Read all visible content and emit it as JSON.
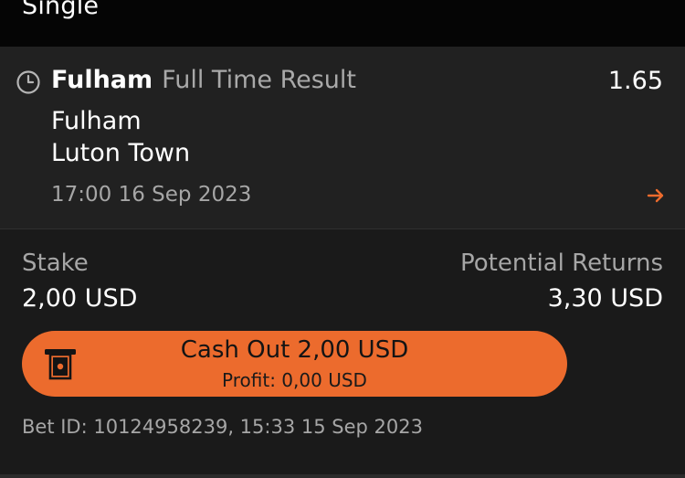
{
  "header": {
    "title": "Single"
  },
  "selection": {
    "team": "Fulham",
    "market": "Full Time Result",
    "odds": "1.65",
    "home_team": "Fulham",
    "away_team": "Luton Town",
    "kickoff": "17:00 16 Sep 2023",
    "icons": {
      "status": "clock-icon",
      "navigate": "arrow-right-icon"
    }
  },
  "bet": {
    "stake_label": "Stake",
    "stake_value": "2,00 USD",
    "returns_label": "Potential Returns",
    "returns_value": "3,30 USD",
    "cashout": {
      "label": "Cash Out 2,00 USD",
      "profit": "Profit: 0,00 USD",
      "icon": "cash-out-icon"
    },
    "bet_id": "Bet ID: 10124958239, 15:33 15 Sep 2023"
  },
  "colors": {
    "accent": "#ec6b2d",
    "background": "#1a1a1a",
    "card": "#212121",
    "header": "#050505",
    "muted_text": "#a6a6a6"
  }
}
